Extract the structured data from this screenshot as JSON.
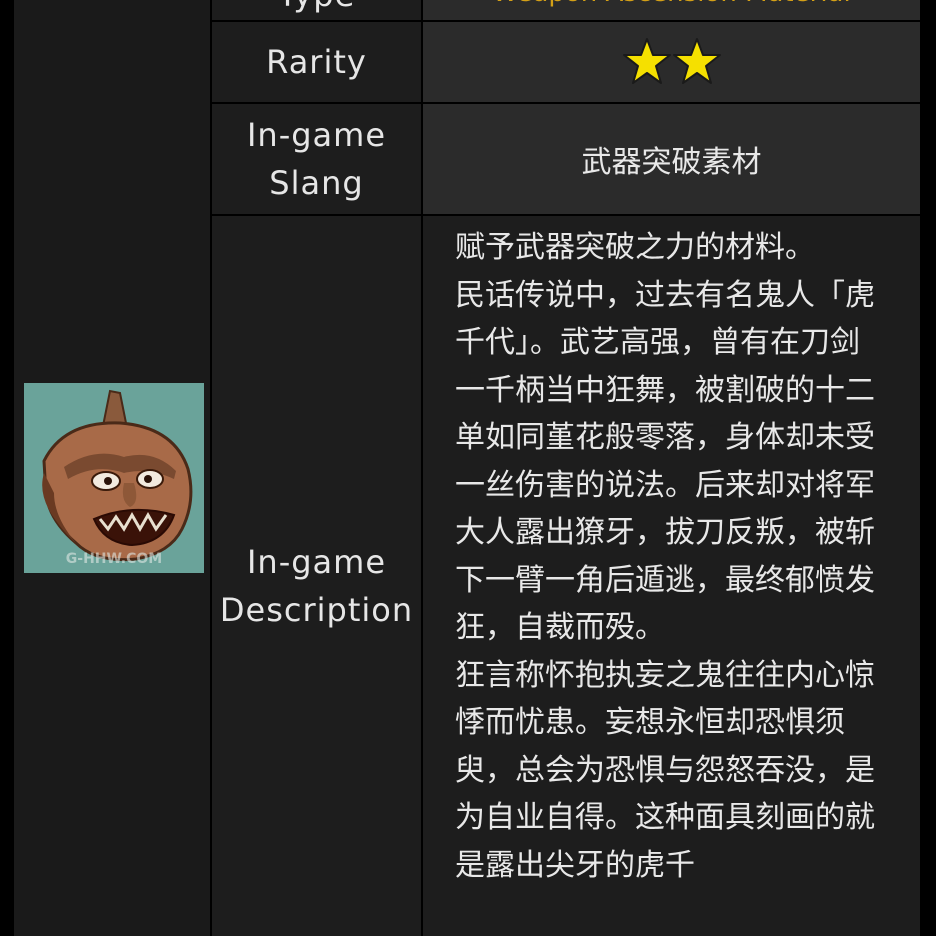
{
  "table": {
    "type_label": "Type",
    "type_value": "Weapon Ascension Material",
    "rarity_label": "Rarity",
    "rarity_stars": 2,
    "rarity_icon": "star-icon",
    "star_color": "#f5e000",
    "slang_label": "In-game Slang",
    "slang_value": "武器突破素材",
    "description_label": "In-game Description",
    "description_value": "赋予武器突破之力的材料。\n民话传说中，过去有名鬼人「虎千代」。武艺高强，曾有在刀剑一千柄当中狂舞，被割破的十二单如同堇花般零落，身体却未受一丝伤害的说法。后来却对将军大人露出獠牙，拔刀反叛，被斩下一臂一角后遁逃，最终郁愤发狂，自裁而殁。\n狂言称怀抱执妄之鬼往往内心惊悸而忧患。妄想永恒却恐惧须臾，总会为恐惧与怨怒吞没，是为自业自得。这种面具刻画的就是露出尖牙的虎千"
  },
  "item_image": {
    "icon": "oni-mask-icon",
    "watermark": "G-HHW.COM"
  }
}
